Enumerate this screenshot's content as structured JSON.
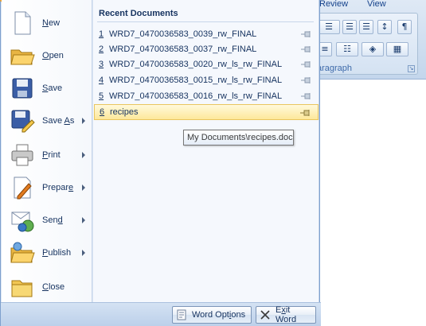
{
  "ribbon": {
    "tabs": [
      "Review",
      "View"
    ],
    "group_label": "Paragraph",
    "visible_group_label": "aragraph",
    "buttons": [
      "☰",
      "☰",
      "↕",
      "¶",
      "≡",
      "☷",
      "◈",
      "▦"
    ]
  },
  "menu": {
    "commands": [
      {
        "label": "New",
        "accel": "N",
        "rest": "ew",
        "icon": "new-document-icon",
        "submenu": false
      },
      {
        "label": "Open",
        "accel": "O",
        "rest": "pen",
        "icon": "open-folder-icon",
        "submenu": false
      },
      {
        "label": "Save",
        "accel": "S",
        "rest": "ave",
        "icon": "save-disk-icon",
        "submenu": false
      },
      {
        "label": "Save As",
        "pre": "Save ",
        "accel": "A",
        "rest": "s",
        "icon": "save-as-icon",
        "submenu": true
      },
      {
        "label": "Print",
        "accel": "P",
        "rest": "rint",
        "icon": "printer-icon",
        "submenu": true
      },
      {
        "label": "Prepare",
        "pre": "Prepar",
        "accel": "e",
        "rest": "",
        "icon": "prepare-icon",
        "submenu": true
      },
      {
        "label": "Send",
        "pre": "Sen",
        "accel": "d",
        "rest": "",
        "icon": "send-icon",
        "submenu": true
      },
      {
        "label": "Publish",
        "accel": "P",
        "rest": "ublish",
        "pre": "",
        "icon": "publish-icon",
        "submenu": true
      },
      {
        "label": "Close",
        "accel": "C",
        "rest": "lose",
        "icon": "close-folder-icon",
        "submenu": false
      }
    ],
    "recent_title": "Recent Documents",
    "recent_docs": [
      {
        "num": "1",
        "name": "WRD7_0470036583_0039_rw_FINAL"
      },
      {
        "num": "2",
        "name": "WRD7_0470036583_0037_rw_FINAL"
      },
      {
        "num": "3",
        "name": "WRD7_0470036583_0020_rw_ls_rw_FINAL"
      },
      {
        "num": "4",
        "name": "WRD7_0470036583_0015_rw_ls_rw_FINAL"
      },
      {
        "num": "5",
        "name": "WRD7_0470036583_0016_rw_ls_rw_FINAL"
      },
      {
        "num": "6",
        "name": "recipes"
      }
    ],
    "tooltip": "My Documents\\recipes.doc",
    "footer": {
      "word_options": "Word Options",
      "word_options_pre": "Word Opt",
      "word_options_accel": "i",
      "word_options_rest": "ons",
      "exit_word": "Exit Word",
      "exit_pre": "E",
      "exit_accel": "x",
      "exit_rest": "it Word"
    }
  },
  "colors": {
    "menu_bg": "#dbe6f4",
    "highlight": "#fde89a",
    "text": "#15325f"
  }
}
